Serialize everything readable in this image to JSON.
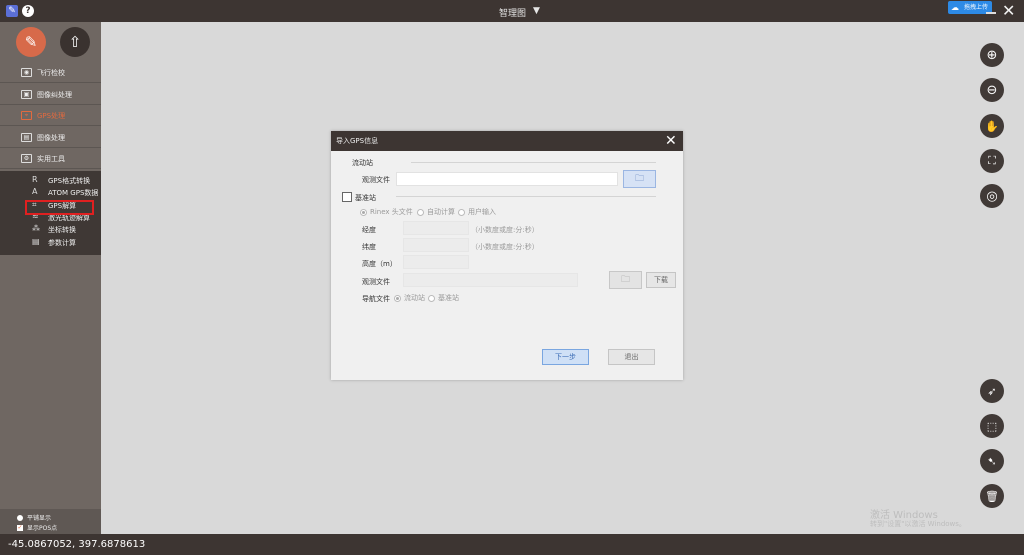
{
  "titlebar": {
    "title": "智理图",
    "dropdown_icon": "▼",
    "badge": "拖拽上传",
    "close_icon": "✕"
  },
  "sidebar": {
    "top_buttons": [
      {
        "name": "measure-icon",
        "glyph": "✎"
      },
      {
        "name": "upload-icon",
        "glyph": "⇧"
      }
    ],
    "nav": [
      {
        "label": "飞行检校"
      },
      {
        "label": "图像纠处理"
      },
      {
        "label": "GPS处理"
      },
      {
        "label": "图像处理"
      },
      {
        "label": "实用工具"
      }
    ],
    "submenu": [
      {
        "label": "GPS格式转换",
        "icon": "R"
      },
      {
        "label": "ATOM GPS数据",
        "icon": "A"
      },
      {
        "label": "GPS解算",
        "icon": "⌗"
      },
      {
        "label": "激光轨迹解算",
        "icon": "≈"
      },
      {
        "label": "坐标转换",
        "icon": "⁂"
      },
      {
        "label": "参数计算",
        "icon": "▤"
      }
    ],
    "options": [
      {
        "label": "平铺显示"
      },
      {
        "label": "显示POS点"
      }
    ]
  },
  "tools": [
    {
      "name": "zoom-in-icon",
      "glyph": "⊕"
    },
    {
      "name": "zoom-out-icon",
      "glyph": "⊖"
    },
    {
      "name": "pan-hand-icon",
      "glyph": "✋"
    },
    {
      "name": "fullscreen-icon",
      "glyph": "⛶"
    },
    {
      "name": "globe-icon",
      "glyph": "◎"
    },
    {
      "name": "select-arrow-icon",
      "glyph": "➶"
    },
    {
      "name": "select-area-icon",
      "glyph": "⬚"
    },
    {
      "name": "select-lasso-icon",
      "glyph": "➷"
    },
    {
      "name": "trash-icon",
      "glyph": "🗑"
    }
  ],
  "status": {
    "coords": "-45.0867052, 397.6878613"
  },
  "watermark": {
    "line1": "激活 Windows",
    "line2": "转到\"设置\"以激活 Windows。"
  },
  "dialog": {
    "title": "导入GPS信息",
    "close_icon": "✕",
    "rover_section": "流动站",
    "obs_file_label": "观测文件",
    "obs_file_value": "",
    "folder_icon": "🗀",
    "base_section": "基准站",
    "base_checked": false,
    "source_options": [
      "Rinex 头文件",
      "自动计算",
      "用户输入"
    ],
    "source_selected": 0,
    "lon_label": "经度",
    "lon_hint": "（小数度或度:分:秒）",
    "lat_label": "纬度",
    "lat_hint": "（小数度或度:分:秒）",
    "height_label": "高度（m）",
    "base_obs_label": "观测文件",
    "download_label": "下载",
    "nav_file_label": "导航文件",
    "nav_options": [
      "流动站",
      "基准站"
    ],
    "nav_selected": 0,
    "next_label": "下一步",
    "exit_label": "退出"
  }
}
